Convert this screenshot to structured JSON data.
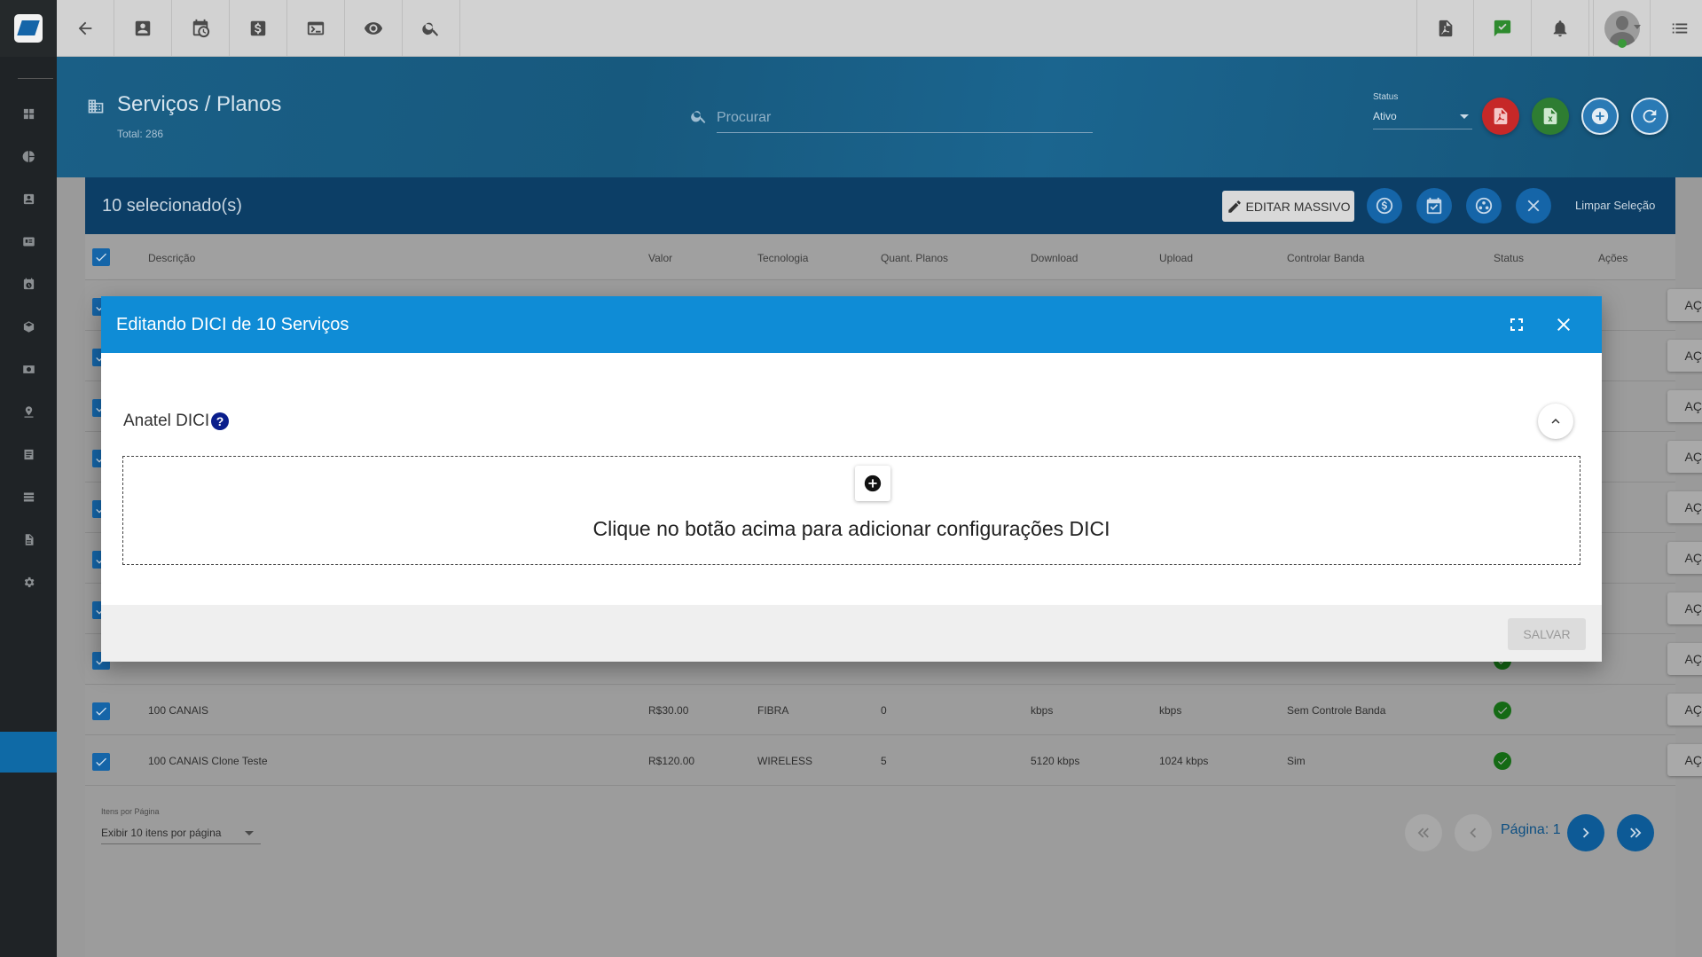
{
  "page": {
    "title": "Serviços / Planos",
    "total": "Total: 286",
    "search_placeholder": "Procurar",
    "status_label": "Status",
    "status_value": "Ativo"
  },
  "selection": {
    "count_text": "10 selecionado(s)",
    "edit_mass_label": "EDITAR MASSIVO",
    "clear_label": "Limpar Seleção"
  },
  "table": {
    "headers": [
      "Descrição",
      "Valor",
      "Tecnologia",
      "Quant. Planos",
      "Download",
      "Upload",
      "Controlar Banda",
      "Status",
      "Ações"
    ],
    "action_label": "AÇÕES",
    "rows": [
      {
        "descricao": "100 CANAIS",
        "valor": "R$30.00",
        "tecnologia": "FIBRA",
        "quant": "0",
        "download": "kbps",
        "upload": "kbps",
        "banda": "Sem Controle Banda"
      },
      {
        "descricao": "100 CANAIS Clone Teste",
        "valor": "R$120.00",
        "tecnologia": "WIRELESS",
        "quant": "5",
        "download": "5120 kbps",
        "upload": "1024 kbps",
        "banda": "Sim"
      }
    ]
  },
  "pagination": {
    "items_label": "Itens por Página",
    "items_value": "Exibir 10 itens por página",
    "page_label": "Página: 1"
  },
  "modal": {
    "title": "Editando DICI de 10 Serviços",
    "section_title": "Anatel DICI",
    "help_glyph": "?",
    "empty_message": "Clique no botão acima para adicionar configurações DICI",
    "save_label": "SALVAR"
  },
  "colors": {
    "accent": "#0f8cd6",
    "header": "#1a5f86",
    "selection_bar": "#0c3e66",
    "pdf_red": "#c62828",
    "excel_green": "#2e7d32",
    "primary_blue": "#1565a8"
  }
}
